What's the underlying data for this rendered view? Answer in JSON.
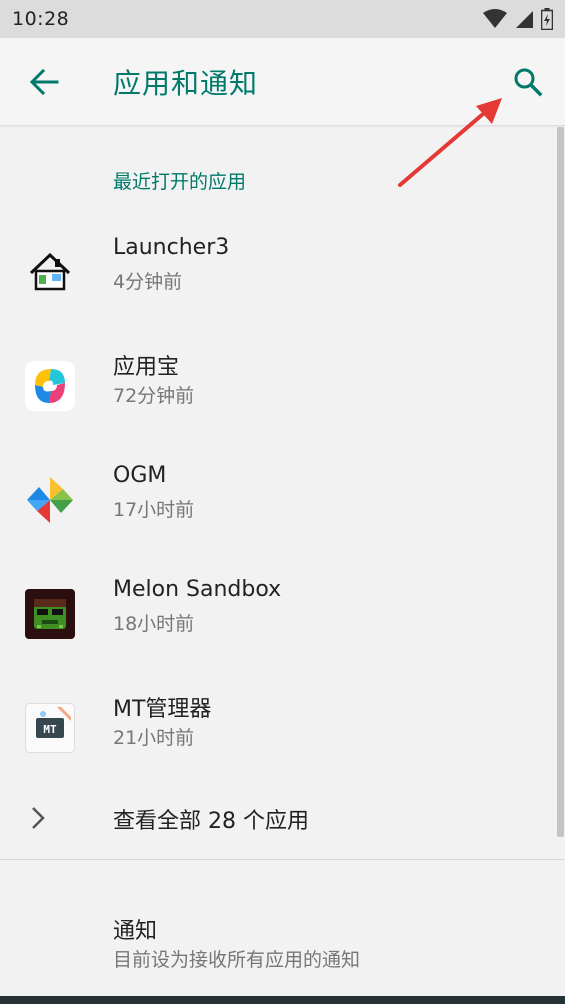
{
  "status_bar": {
    "time": "10:28"
  },
  "toolbar": {
    "title": "应用和通知"
  },
  "recent": {
    "header": "最近打开的应用",
    "apps": [
      {
        "name": "Launcher3",
        "time": "4分钟前"
      },
      {
        "name": "应用宝",
        "time": "72分钟前"
      },
      {
        "name": "OGM",
        "time": "17小时前"
      },
      {
        "name": "Melon Sandbox",
        "time": "18小时前"
      },
      {
        "name": "MT管理器",
        "time": "21小时前"
      }
    ],
    "see_all": "查看全部 28 个应用"
  },
  "notifications": {
    "title": "通知",
    "subtitle": "目前设为接收所有应用的通知"
  },
  "colors": {
    "accent": "#00796b",
    "annotation": "#e53935"
  },
  "icons": {
    "back": "arrow-back-icon",
    "search": "search-icon",
    "chevron": "chevron-right-icon"
  }
}
